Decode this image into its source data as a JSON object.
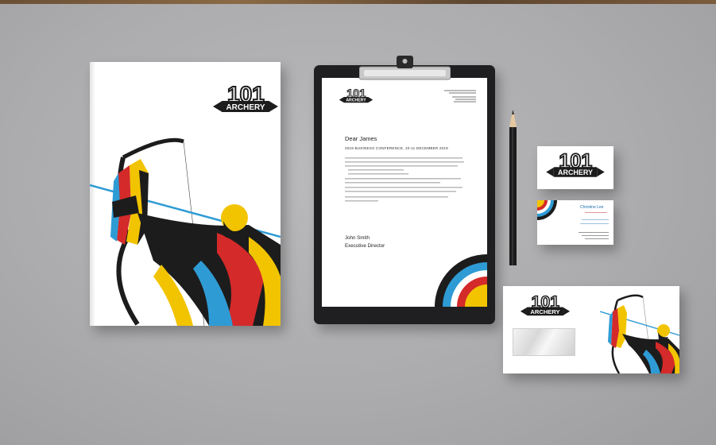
{
  "brand": {
    "logo_top": "101",
    "logo_word": "ARCHERY",
    "colors": {
      "yellow": "#f2c400",
      "red": "#d42a2a",
      "blue": "#2f9bd4",
      "black": "#1c1c1c",
      "white": "#ffffff"
    }
  },
  "letter": {
    "greeting": "Dear James",
    "subject": "2019 BUSINESS CONFERENCE, 10-11 DECEMBER 2019",
    "signer_name": "John Smith",
    "signer_title": "Executive Director"
  },
  "business_card": {
    "name": "Christine Lee"
  }
}
